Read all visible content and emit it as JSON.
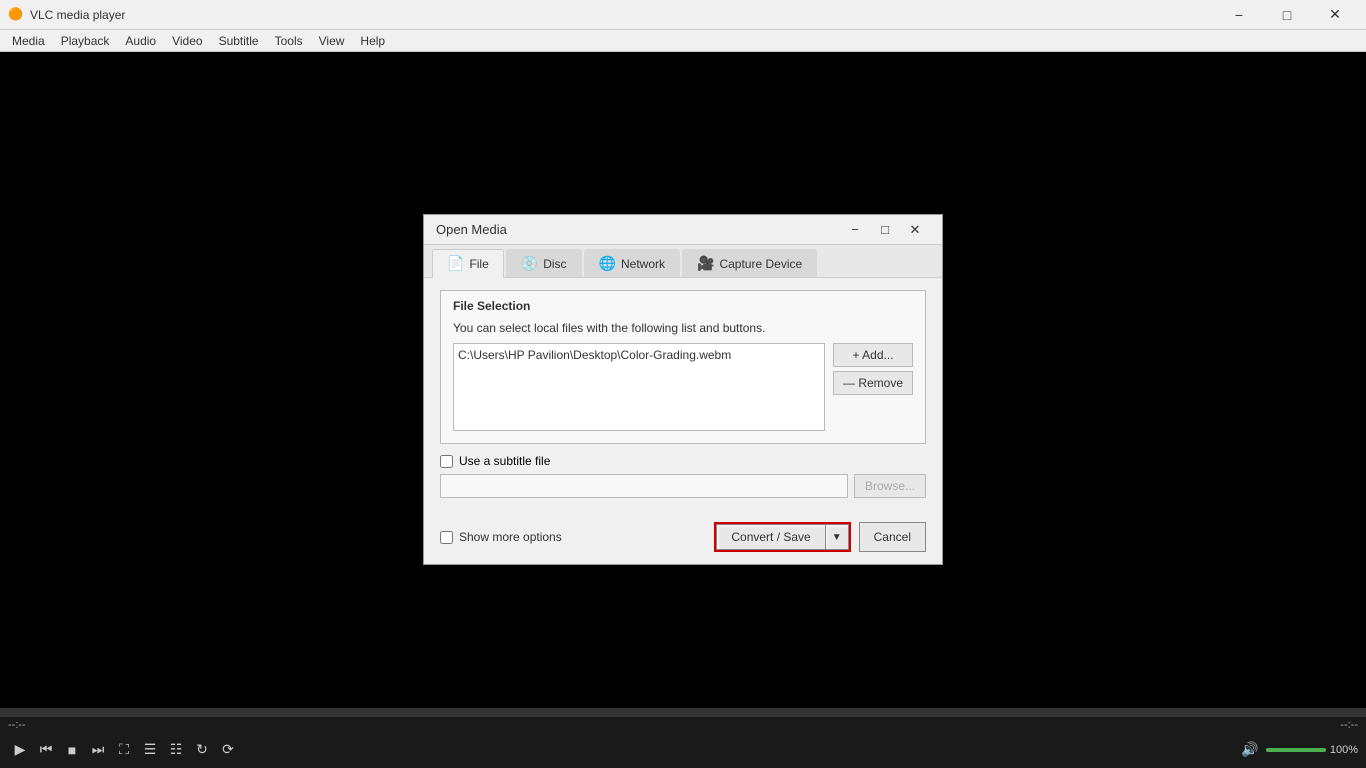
{
  "app": {
    "title": "VLC media player",
    "icon": "🎭"
  },
  "menubar": {
    "items": [
      "Media",
      "Playback",
      "Audio",
      "Video",
      "Subtitle",
      "Tools",
      "View",
      "Help"
    ]
  },
  "dialog": {
    "title": "Open Media",
    "tabs": [
      {
        "id": "file",
        "label": "File",
        "icon": "📄"
      },
      {
        "id": "disc",
        "label": "Disc",
        "icon": "💿"
      },
      {
        "id": "network",
        "label": "Network",
        "icon": "🌐"
      },
      {
        "id": "capture",
        "label": "Capture Device",
        "icon": "🎥"
      }
    ],
    "file_selection": {
      "group_title": "File Selection",
      "description": "You can select local files with the following list and buttons.",
      "file_path": "C:\\Users\\HP Pavilion\\Desktop\\Color-Grading.webm",
      "add_button": "+ Add...",
      "remove_button": "— Remove"
    },
    "subtitle": {
      "checkbox_label": "Use a subtitle file",
      "input_placeholder": "",
      "browse_label": "Browse..."
    },
    "show_more_label": "Show more options",
    "convert_save_label": "Convert / Save",
    "cancel_label": "Cancel"
  },
  "bottom_bar": {
    "time_left": "--:--",
    "time_right": "--:--",
    "volume_label": "100%"
  }
}
